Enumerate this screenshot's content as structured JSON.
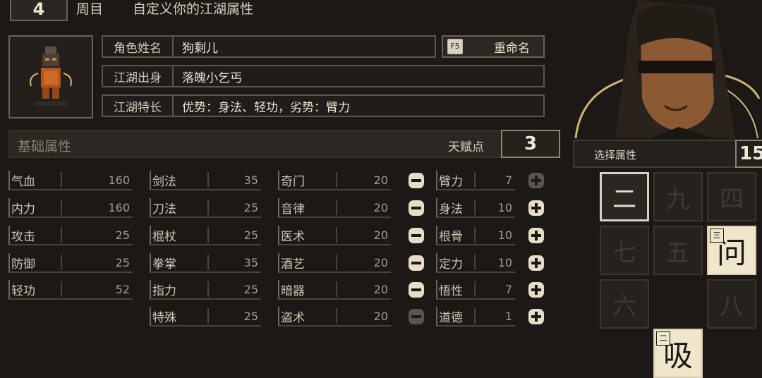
{
  "header": {
    "round_number": "4",
    "round_label": "周目",
    "title": "自定义你的江湖属性"
  },
  "profile": {
    "name_label": "角色姓名",
    "name_value": "狗剩儿",
    "rename_key": "F5",
    "rename_label": "重命名",
    "origin_label": "江湖出身",
    "origin_value": "落魄小乞丐",
    "trait_label": "江湖特长",
    "trait_value": "优势：身法、轻功，劣势：臂力"
  },
  "basic": {
    "title": "基础属性",
    "talent_label": "天赋点",
    "talent_value": "3"
  },
  "col1": [
    {
      "name": "气血",
      "value": "160"
    },
    {
      "name": "内力",
      "value": "160"
    },
    {
      "name": "攻击",
      "value": "25"
    },
    {
      "name": "防御",
      "value": "25"
    },
    {
      "name": "轻功",
      "value": "52"
    }
  ],
  "col2": [
    {
      "name": "剑法",
      "value": "35"
    },
    {
      "name": "刀法",
      "value": "25"
    },
    {
      "name": "棍杖",
      "value": "25"
    },
    {
      "name": "拳掌",
      "value": "35"
    },
    {
      "name": "指力",
      "value": "25"
    },
    {
      "name": "特殊",
      "value": "25"
    }
  ],
  "col3": [
    {
      "name": "奇门",
      "value": "20"
    },
    {
      "name": "音律",
      "value": "20"
    },
    {
      "name": "医术",
      "value": "20"
    },
    {
      "name": "酒艺",
      "value": "20"
    },
    {
      "name": "暗器",
      "value": "20"
    },
    {
      "name": "盗术",
      "value": "20"
    }
  ],
  "col4": [
    {
      "name": "臂力",
      "value": "7"
    },
    {
      "name": "身法",
      "value": "10"
    },
    {
      "name": "根骨",
      "value": "10"
    },
    {
      "name": "定力",
      "value": "10"
    },
    {
      "name": "悟性",
      "value": "7"
    },
    {
      "name": "道德",
      "value": "1"
    }
  ],
  "select": {
    "title": "选择属性",
    "value": "15"
  },
  "grid": [
    {
      "char": "二",
      "state": "selected"
    },
    {
      "char": "九",
      "state": "dim"
    },
    {
      "char": "四",
      "state": "dim"
    },
    {
      "char": "七",
      "state": "dim"
    },
    {
      "char": "五",
      "state": "dim"
    },
    {
      "char": "问",
      "state": "card",
      "badge": "三"
    },
    {
      "char": "六",
      "state": "dim"
    },
    {
      "char": "吸",
      "state": "card",
      "badge": "二"
    },
    {
      "char": "八",
      "state": "dim"
    }
  ],
  "colors": {
    "accent": "#d8d0c0",
    "frame": "#5d554b",
    "background": "#1b1815"
  },
  "icons": {
    "minus": "minus-circle-icon",
    "plus": "plus-circle-icon"
  }
}
